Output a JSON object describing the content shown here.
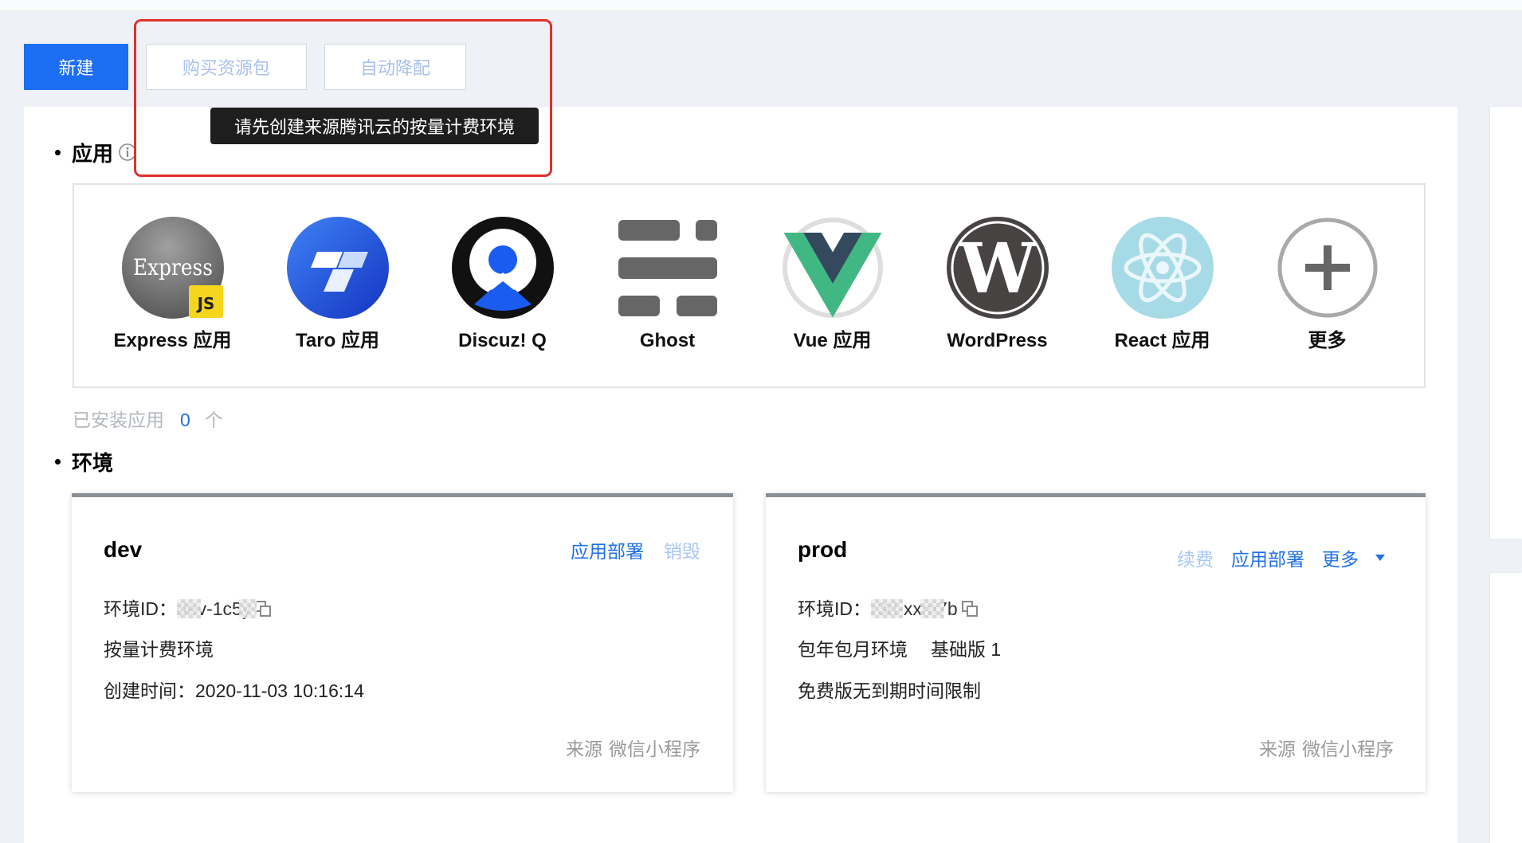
{
  "toolbar": {
    "new_button": "新建",
    "buy_package_button": "购买资源包",
    "auto_downgrade_button": "自动降配"
  },
  "tooltip": "请先创建来源腾讯云的按量计费环境",
  "apps": {
    "title": "应用",
    "info_icon": "info-icon",
    "items": [
      {
        "label": "Express 应用",
        "icon": "express-icon",
        "logo_text": "Express",
        "badge_text": "JS"
      },
      {
        "label": "Taro 应用",
        "icon": "taro-icon"
      },
      {
        "label": "Discuz! Q",
        "icon": "discuz-q-icon"
      },
      {
        "label": "Ghost",
        "icon": "ghost-icon"
      },
      {
        "label": "Vue 应用",
        "icon": "vue-icon"
      },
      {
        "label": "WordPress",
        "icon": "wordpress-icon",
        "logo_text": "W"
      },
      {
        "label": "React 应用",
        "icon": "react-icon"
      },
      {
        "label": "更多",
        "icon": "plus-circle-icon"
      }
    ],
    "installed": {
      "label": "已安装应用",
      "count": "0",
      "unit": "个"
    }
  },
  "environments": {
    "title": "环境",
    "cards": [
      {
        "name": "dev",
        "actions": [
          {
            "label": "应用部署",
            "disabled": false
          },
          {
            "label": "销毁",
            "disabled": true
          }
        ],
        "id_label": "环境ID：",
        "id_value": "dev-1c5y",
        "billing": "按量计费环境",
        "created_label": "创建时间：",
        "created_value": "2020-11-03 10:16:14",
        "source_label": "来源",
        "source_value": "微信小程序"
      },
      {
        "name": "prod",
        "actions": [
          {
            "label": "续费",
            "disabled": true
          },
          {
            "label": "应用部署",
            "disabled": false
          },
          {
            "label": "更多",
            "disabled": false
          }
        ],
        "id_label": "环境ID：",
        "id_value": "r3d-xxm7b",
        "plan": "包年包月环境",
        "tier": "基础版 1",
        "expiry": "免费版无到期时间限制",
        "source_label": "来源",
        "source_value": "微信小程序"
      }
    ]
  },
  "colors": {
    "primary": "#1c6ef2",
    "link": "#1f6fe5",
    "disabled_text": "#a8c0ec",
    "highlight_border": "#e0302c",
    "tooltip_bg": "#1e1e1e"
  }
}
